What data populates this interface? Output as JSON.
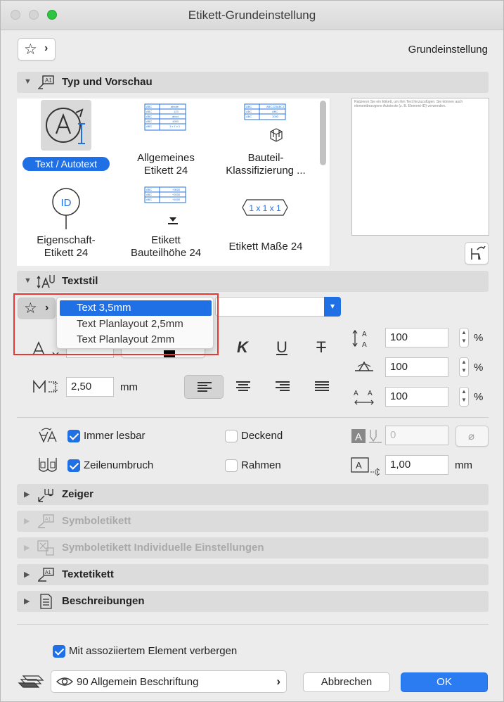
{
  "window": {
    "title": "Etikett-Grundeinstellung"
  },
  "header": {
    "favorites_chevron": "›",
    "right_label": "Grundeinstellung"
  },
  "sections": {
    "typ": "Typ und Vorschau",
    "textstil": "Textstil",
    "zeiger": "Zeiger",
    "symboletikett": "Symboletikett",
    "symboletikett_ind": "Symboletikett Individuelle Einstellungen",
    "textetikett": "Textetikett",
    "beschreibungen": "Beschreibungen"
  },
  "gallery": {
    "items": [
      {
        "label": "Text / Autotext"
      },
      {
        "label1": "Allgemeines",
        "label2": "Etikett 24"
      },
      {
        "label1": "Bauteil-",
        "label2": "Klassifizierung ..."
      },
      {
        "label1": "Eigenschaft-",
        "label2": "Etikett 24"
      },
      {
        "label1": "Etikett",
        "label2": "Bauteilhöhe 24"
      },
      {
        "label1": "Etikett Maße 24"
      }
    ],
    "id_text": "ID",
    "dims_text": "1 x 1 x 1"
  },
  "preview": {
    "text": "Ratzieren Sie ein Etikett, um ihm Text hinzuzufügen. Sie können auch elementbezogene Autotexte (z. B. Element-ID) verwenden."
  },
  "textstil": {
    "menu_items": [
      "Text 3,5mm",
      "Text Planlayout 2,5mm",
      "Text Planlayout 2mm"
    ],
    "size_value": "2,50",
    "size_unit": "mm",
    "spacing": [
      {
        "value": "100",
        "unit": "%"
      },
      {
        "value": "100",
        "unit": "%"
      },
      {
        "value": "100",
        "unit": "%"
      }
    ]
  },
  "options": {
    "immer_lesbar": "Immer lesbar",
    "zeilenumbruch": "Zeilenumbruch",
    "deckend": "Deckend",
    "rahmen": "Rahmen",
    "pen_value": "0",
    "frame_offset": "1,00",
    "frame_unit": "mm",
    "empty_symbol": "⌀"
  },
  "footer": {
    "hide_with_element": "Mit assoziiertem Element verbergen",
    "layer": "90 Allgemein Beschriftung",
    "layer_chevron": "›",
    "cancel": "Abbrechen",
    "ok": "OK"
  },
  "colors": {
    "accent": "#1f6fe5",
    "highlight_outline": "#e53935"
  }
}
